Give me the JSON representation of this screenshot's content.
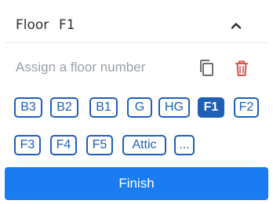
{
  "header": {
    "label": "Floor",
    "value": "F1"
  },
  "input": {
    "value": "",
    "placeholder": "Assign a floor number"
  },
  "icons": {
    "collapse": "chevron-up-icon",
    "copy": "copy-icon",
    "delete": "trash-icon"
  },
  "floors": [
    {
      "label": "B3",
      "selected": false
    },
    {
      "label": "B2",
      "selected": false
    },
    {
      "label": "B1",
      "selected": false
    },
    {
      "label": "G",
      "selected": false
    },
    {
      "label": "HG",
      "selected": false
    },
    {
      "label": "F1",
      "selected": true
    },
    {
      "label": "F2",
      "selected": false
    },
    {
      "label": "F3",
      "selected": false
    },
    {
      "label": "F4",
      "selected": false
    },
    {
      "label": "F5",
      "selected": false
    },
    {
      "label": "Attic",
      "selected": false
    },
    {
      "label": "...",
      "selected": false
    }
  ],
  "actions": {
    "finish_label": "Finish"
  },
  "colors": {
    "accent": "#1f5fb8",
    "primary_button": "#1a7cf0",
    "delete_icon": "#d9534f"
  }
}
